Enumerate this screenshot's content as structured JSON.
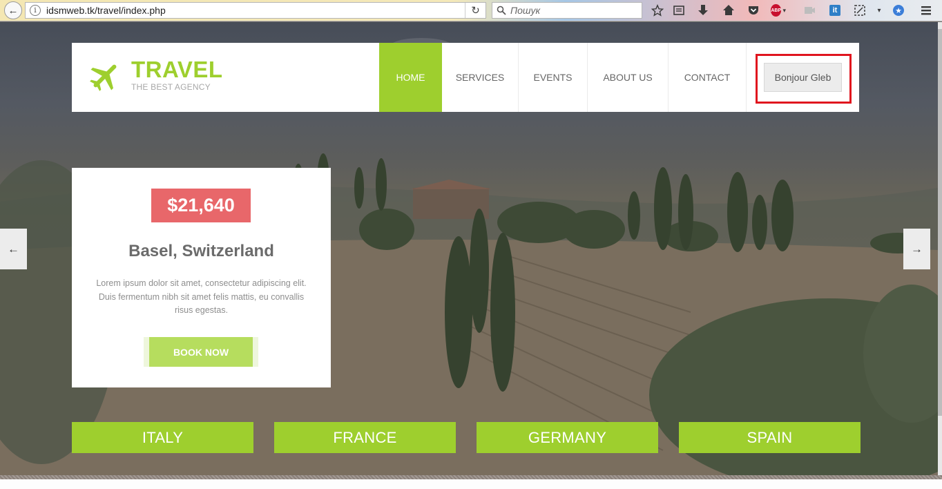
{
  "browser": {
    "url": "idsmweb.tk/travel/index.php",
    "search_placeholder": "Пошук",
    "back_glyph": "←",
    "reload_glyph": "↻",
    "info_glyph": "i",
    "abp_label": "ABP",
    "ext_label": "it",
    "toolbar_icons": [
      "star-icon",
      "reading-list-icon",
      "download-icon",
      "home-icon",
      "pocket-icon",
      "adblock-icon",
      "extension-icon",
      "it-extension-icon",
      "screenshot-icon",
      "menu-arrow-icon",
      "bookmark-badge-icon",
      "hamburger-menu-icon"
    ]
  },
  "logo": {
    "title": "TRAVEL",
    "tagline": "THE BEST AGENCY"
  },
  "nav": {
    "items": [
      {
        "label": "HOME",
        "active": true
      },
      {
        "label": "SERVICES"
      },
      {
        "label": "EVENTS"
      },
      {
        "label": "ABOUT US"
      },
      {
        "label": "CONTACT"
      }
    ],
    "user_button": "Bonjour Gleb"
  },
  "promo": {
    "price": "$21,640",
    "place": "Basel, Switzerland",
    "description": "Lorem ipsum dolor sit amet, consectetur adipiscing elit. Duis fermentum nibh sit amet felis mattis, eu convallis risus egestas.",
    "cta": "BOOK NOW"
  },
  "slider": {
    "prev": "←",
    "next": "→"
  },
  "destinations": [
    "ITALY",
    "FRANCE",
    "GERMANY",
    "SPAIN"
  ],
  "colors": {
    "accent": "#9ecf2e",
    "price_bg": "#e8676a",
    "highlight": "#e0141e"
  }
}
